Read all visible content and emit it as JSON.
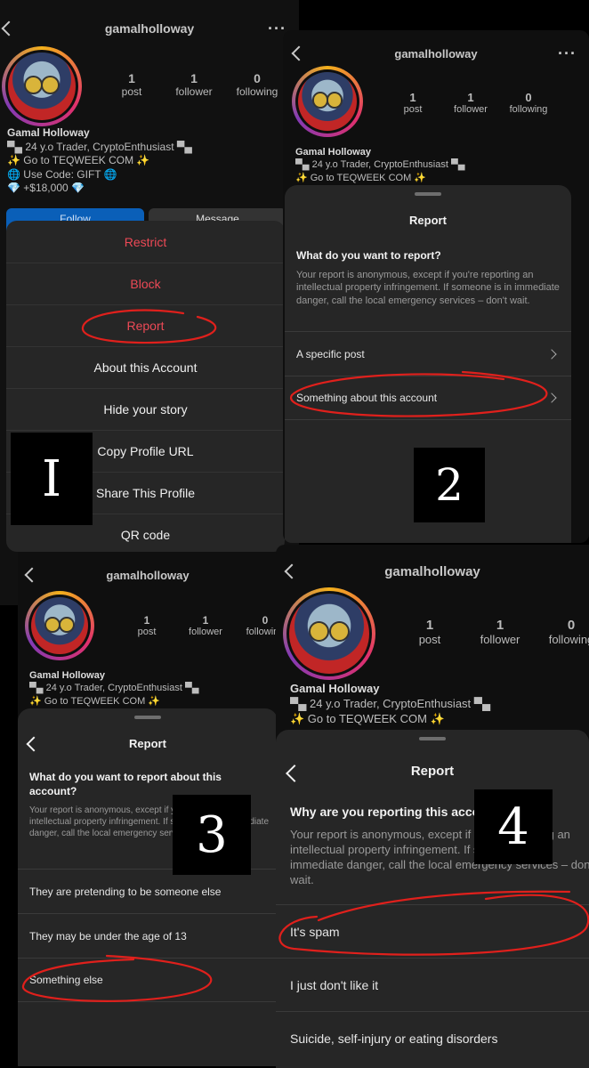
{
  "profile": {
    "username": "gamalholloway",
    "name": "Gamal Holloway",
    "stats": [
      {
        "value": "1",
        "label": "post"
      },
      {
        "value": "1",
        "label": "follower"
      },
      {
        "value": "0",
        "label": "following"
      }
    ],
    "bio": [
      "▀▄ 24 y.o Trader, CryptoEnthusiast ▀▄",
      "✨ Go to TEQWEEK COM ✨",
      "🌐 Use Code: GIFT 🌐",
      "💎 +$18,000 💎"
    ],
    "buttons": {
      "follow": "Follow",
      "message": "Message"
    }
  },
  "menu": {
    "items": [
      "Restrict",
      "Block",
      "Report",
      "About this Account",
      "Hide your story",
      "Copy Profile URL",
      "Share This Profile",
      "QR code"
    ],
    "destructive_color": "#ed4956"
  },
  "step_labels": [
    "I",
    "2",
    "3",
    "4"
  ],
  "panel2": {
    "sheet_title": "Report",
    "question": "What do you want to report?",
    "description": "Your report is anonymous, except if you're reporting an intellectual property infringement. If someone is in immediate danger, call the local emergency services – don't wait.",
    "options": [
      "A specific post",
      "Something about this account"
    ]
  },
  "panel3": {
    "sheet_title": "Report",
    "question": "What do you want to report about this account?",
    "description": "Your report is anonymous, except if you're reporting an intellectual property infringement. If someone is in immediate danger, call the local emergency services – don't wait.",
    "options": [
      "They are pretending to be someone else",
      "They may be under the age of 13",
      "Something else"
    ]
  },
  "panel4": {
    "sheet_title": "Report",
    "question": "Why are you reporting this account?",
    "description": "Your report is anonymous, except if you're reporting an intellectual property infringement. If someone is in immediate danger, call the local emergency services – don't wait.",
    "options": [
      "It's spam",
      "I just don't like it",
      "Suicide, self-injury or eating disorders"
    ]
  },
  "annotation_color": "#e0201c"
}
